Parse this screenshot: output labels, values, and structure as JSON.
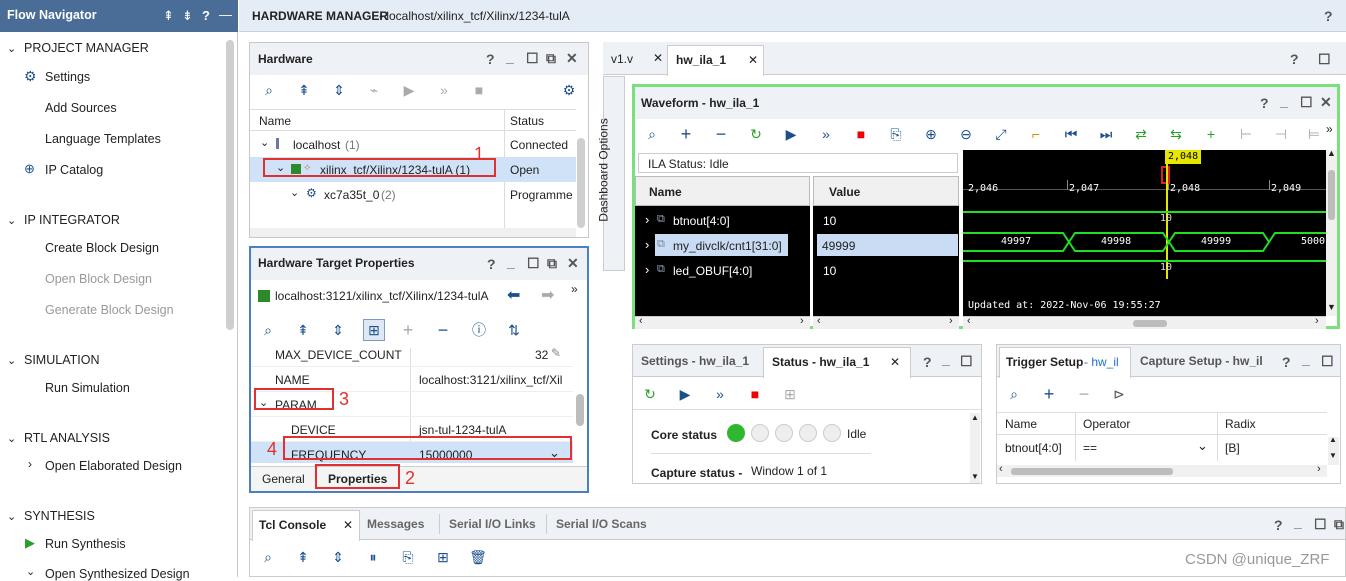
{
  "flow": {
    "title": "Flow Navigator",
    "controls": [
      "⇞",
      "⇟",
      "?",
      "—"
    ],
    "sections": [
      {
        "label": "PROJECT MANAGER"
      },
      {
        "label": "IP INTEGRATOR"
      },
      {
        "label": "SIMULATION"
      },
      {
        "label": "RTL ANALYSIS"
      },
      {
        "label": "SYNTHESIS"
      }
    ],
    "items": {
      "settings": "Settings",
      "add_sources": "Add Sources",
      "language_templates": "Language Templates",
      "ip_catalog": "IP Catalog",
      "create_bd": "Create Block Design",
      "open_bd": "Open Block Design",
      "generate_bd": "Generate Block Design",
      "run_sim": "Run Simulation",
      "open_elab": "Open Elaborated Design",
      "run_synth": "Run Synthesis",
      "open_synth": "Open Synthesized Design"
    }
  },
  "header": {
    "title": "HARDWARE MANAGER",
    "path": " - localhost/xilinx_tcf/Xilinx/1234-tulA",
    "help": "?"
  },
  "hardware": {
    "title": "Hardware",
    "col_name": "Name",
    "col_status": "Status",
    "rows": [
      {
        "name": "localhost",
        "count": " (1)",
        "status": "Connected"
      },
      {
        "name": "xilinx_tcf/Xilinx/1234-tulA (1)",
        "count": "",
        "status": "Open"
      },
      {
        "name": "xc7a35t_0",
        "count": " (2)",
        "status": "Programme"
      }
    ]
  },
  "target_props": {
    "title": "Hardware Target Properties",
    "target": "localhost:3121/xilinx_tcf/Xilinx/1234-tulA",
    "rows": [
      {
        "name": "MAX_DEVICE_COUNT",
        "value": "32"
      },
      {
        "name": "NAME",
        "value": "localhost:3121/xilinx_tcf/Xil"
      },
      {
        "name": "PARAM",
        "value": ""
      },
      {
        "name": "DEVICE",
        "value": "jsn-tul-1234-tulA"
      },
      {
        "name": "FREQUENCY",
        "value": "15000000"
      }
    ],
    "tab_general": "General",
    "tab_properties": "Properties"
  },
  "annotations": [
    "1",
    "2",
    "3",
    "4"
  ],
  "editor_tabs": [
    "v1.v",
    "hw_ila_1"
  ],
  "waveform": {
    "title": "Waveform - hw_ila_1",
    "ila_status": "ILA Status:  Idle",
    "col_name": "Name",
    "col_value": "Value",
    "cursor": "2,048",
    "ticks": [
      "2,046",
      "2,047",
      "2,048",
      "2,049"
    ],
    "signals": [
      {
        "name": "btnout[4:0]",
        "value": "10",
        "wave_label": "10"
      },
      {
        "name": "my_divclk/cnt1[31:0]",
        "value": "49999",
        "segments": [
          "49997",
          "49998",
          "49999",
          "5000"
        ]
      },
      {
        "name": "led_OBUF[4:0]",
        "value": "10",
        "wave_label": "10"
      }
    ],
    "updated": "Updated at: 2022-Nov-06 19:55:27",
    "dashboard": "Dashboard Options"
  },
  "status_panel": {
    "tab_settings": "Settings - hw_ila_1",
    "tab_status": "Status - hw_ila_1",
    "core_status_label": "Core status",
    "core_status_value": "Idle",
    "capture_label": "Capture status -",
    "capture_value": "Window 1 of 1"
  },
  "trigger_panel": {
    "tab_trigger": "Trigger Setup",
    "tab_trigger_suffix": " - hw_il",
    "tab_capture": "Capture Setup - hw_il",
    "col_name": "Name",
    "col_operator": "Operator",
    "col_radix": "Radix",
    "row_name": "btnout[4:0]",
    "row_op": "==",
    "row_radix": "[B]"
  },
  "console": {
    "tabs": [
      "Tcl Console",
      "Messages",
      "Serial I/O Links",
      "Serial I/O Scans"
    ]
  },
  "watermark": "CSDN @unique_ZRF",
  "colors": {
    "accent_blue": "#1c4f8c",
    "highlight_red": "#e03030",
    "wave_green": "#22dd22",
    "cursor_yellow": "#e6e600",
    "panel_blue_border": "#4a7fc1",
    "panel_green_border": "#6be06b"
  }
}
